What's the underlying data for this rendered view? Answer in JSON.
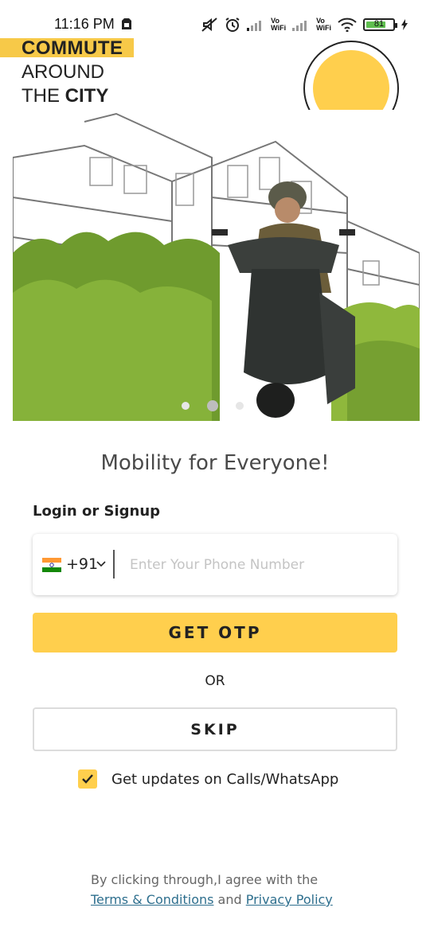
{
  "status_bar": {
    "time": "11:16 PM",
    "battery": "81",
    "vo_wifi_1_top": "Vo",
    "vo_wifi_1_bottom": "WiFi",
    "vo_wifi_2_top": "Vo",
    "vo_wifi_2_bottom": "WiFi"
  },
  "hero": {
    "line1": "COMMUTE",
    "line2": "AROUND",
    "line3_prefix": "THE ",
    "line3_bold": "CITY",
    "accent_color": "#ffcf4d",
    "carousel": {
      "count": 3,
      "active_index": 1
    }
  },
  "main": {
    "tagline": "Mobility for Everyone!",
    "login_label": "Login or Signup",
    "country_code": "+91",
    "phone_placeholder": "Enter Your Phone Number",
    "otp_button": "GET OTP",
    "or_text": "OR",
    "skip_button": "SKIP",
    "consent_label": "Get updates on Calls/WhatsApp",
    "consent_checked": true
  },
  "footer": {
    "line1": "By clicking through,I agree with the",
    "terms_link": "Terms & Conditions",
    "and_text": " and ",
    "privacy_link": "Privacy Policy"
  },
  "icons": {
    "flag": "india-flag-icon",
    "chevron": "chevron-down-icon",
    "check": "check-icon"
  }
}
